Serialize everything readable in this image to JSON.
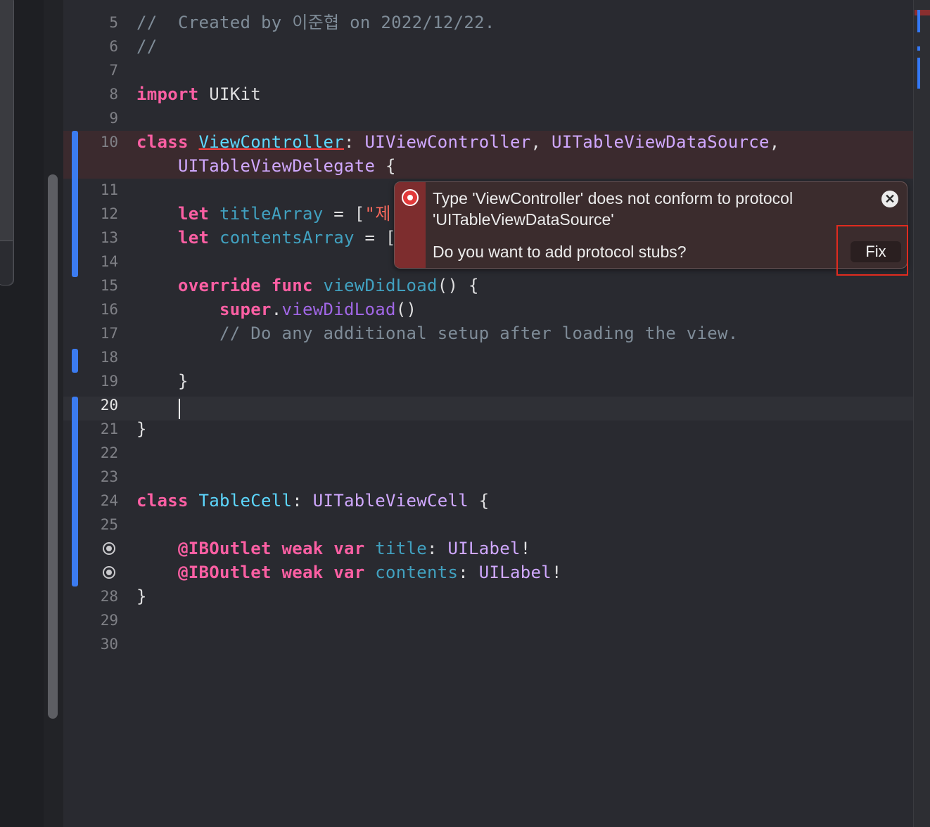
{
  "editor": {
    "lines": [
      {
        "n": "5",
        "segs": [
          {
            "t": "//  Created by 이준협 on 2022/12/22.",
            "c": "cm"
          }
        ]
      },
      {
        "n": "6",
        "segs": [
          {
            "t": "//",
            "c": "cm"
          }
        ]
      },
      {
        "n": "7",
        "segs": []
      },
      {
        "n": "8",
        "segs": [
          {
            "t": "import",
            "c": "kw"
          },
          {
            "t": " UIKit",
            "c": ""
          }
        ]
      },
      {
        "n": "9",
        "segs": []
      },
      {
        "n": "10",
        "segs": [
          {
            "t": "class",
            "c": "kw"
          },
          {
            "t": " ",
            "c": ""
          },
          {
            "t": "ViewController",
            "c": "dc err-underline"
          },
          {
            "t": ": ",
            "c": ""
          },
          {
            "t": "UIViewController",
            "c": "ty"
          },
          {
            "t": ", ",
            "c": ""
          },
          {
            "t": "UITableViewDataSource",
            "c": "ty"
          },
          {
            "t": ",",
            "c": ""
          }
        ]
      },
      {
        "n": "",
        "segs": [
          {
            "t": "    ",
            "c": ""
          },
          {
            "t": "UITableViewDelegate",
            "c": "ty"
          },
          {
            "t": " {",
            "c": ""
          }
        ]
      },
      {
        "n": "11",
        "segs": []
      },
      {
        "n": "12",
        "segs": [
          {
            "t": "    ",
            "c": ""
          },
          {
            "t": "let",
            "c": "kw"
          },
          {
            "t": " ",
            "c": ""
          },
          {
            "t": "titleArray",
            "c": "prop"
          },
          {
            "t": " = [",
            "c": ""
          },
          {
            "t": "\"제",
            "c": "str"
          }
        ]
      },
      {
        "n": "13",
        "segs": [
          {
            "t": "    ",
            "c": ""
          },
          {
            "t": "let",
            "c": "kw"
          },
          {
            "t": " ",
            "c": ""
          },
          {
            "t": "contentsArray",
            "c": "prop"
          },
          {
            "t": " = [",
            "c": ""
          }
        ]
      },
      {
        "n": "14",
        "segs": []
      },
      {
        "n": "15",
        "segs": [
          {
            "t": "    ",
            "c": ""
          },
          {
            "t": "override",
            "c": "kw"
          },
          {
            "t": " ",
            "c": ""
          },
          {
            "t": "func",
            "c": "kw"
          },
          {
            "t": " ",
            "c": ""
          },
          {
            "t": "viewDidLoad",
            "c": "prop"
          },
          {
            "t": "() {",
            "c": ""
          }
        ]
      },
      {
        "n": "16",
        "segs": [
          {
            "t": "        ",
            "c": ""
          },
          {
            "t": "super",
            "c": "kw"
          },
          {
            "t": ".",
            "c": ""
          },
          {
            "t": "viewDidLoad",
            "c": "call"
          },
          {
            "t": "()",
            "c": ""
          }
        ]
      },
      {
        "n": "17",
        "segs": [
          {
            "t": "        ",
            "c": ""
          },
          {
            "t": "// Do any additional setup after loading the view.",
            "c": "cm"
          }
        ]
      },
      {
        "n": "18",
        "segs": []
      },
      {
        "n": "19",
        "segs": [
          {
            "t": "    }",
            "c": ""
          }
        ]
      },
      {
        "n": "20",
        "segs": [],
        "current": true
      },
      {
        "n": "21",
        "segs": [
          {
            "t": "}",
            "c": ""
          }
        ]
      },
      {
        "n": "22",
        "segs": []
      },
      {
        "n": "23",
        "segs": []
      },
      {
        "n": "24",
        "segs": [
          {
            "t": "class",
            "c": "kw"
          },
          {
            "t": " ",
            "c": ""
          },
          {
            "t": "TableCell",
            "c": "dc"
          },
          {
            "t": ": ",
            "c": ""
          },
          {
            "t": "UITableViewCell",
            "c": "ty"
          },
          {
            "t": " {",
            "c": ""
          }
        ]
      },
      {
        "n": "25",
        "segs": []
      },
      {
        "n": "",
        "outlet": true,
        "segs": [
          {
            "t": "    ",
            "c": ""
          },
          {
            "t": "@IBOutlet",
            "c": "kw"
          },
          {
            "t": " ",
            "c": ""
          },
          {
            "t": "weak",
            "c": "kw"
          },
          {
            "t": " ",
            "c": ""
          },
          {
            "t": "var",
            "c": "kw"
          },
          {
            "t": " ",
            "c": ""
          },
          {
            "t": "title",
            "c": "prop"
          },
          {
            "t": ": ",
            "c": ""
          },
          {
            "t": "UILabel",
            "c": "ty"
          },
          {
            "t": "!",
            "c": ""
          }
        ]
      },
      {
        "n": "",
        "outlet": true,
        "segs": [
          {
            "t": "    ",
            "c": ""
          },
          {
            "t": "@IBOutlet",
            "c": "kw"
          },
          {
            "t": " ",
            "c": ""
          },
          {
            "t": "weak",
            "c": "kw"
          },
          {
            "t": " ",
            "c": ""
          },
          {
            "t": "var",
            "c": "kw"
          },
          {
            "t": " ",
            "c": ""
          },
          {
            "t": "contents",
            "c": "prop"
          },
          {
            "t": ": ",
            "c": ""
          },
          {
            "t": "UILabel",
            "c": "ty"
          },
          {
            "t": "!",
            "c": ""
          }
        ]
      },
      {
        "n": "28",
        "segs": [
          {
            "t": "}",
            "c": ""
          }
        ]
      },
      {
        "n": "29",
        "segs": []
      },
      {
        "n": "30",
        "segs": []
      }
    ]
  },
  "issue_popover": {
    "message": "Type 'ViewController' does not conform to protocol 'UITableViewDataSource'",
    "question": "Do you want to add protocol stubs?",
    "fix_label": "Fix",
    "close_glyph": "✕",
    "icon": "error-icon"
  },
  "colors": {
    "background": "#292a30",
    "keyword": "#fc5fa3",
    "type": "#d0a8ff",
    "declaration": "#5dd8ff",
    "comment": "#7f8c98",
    "change_bar": "#3b7bf0",
    "error_row": "#3b2a2e",
    "highlight_box": "#e02b1f"
  }
}
